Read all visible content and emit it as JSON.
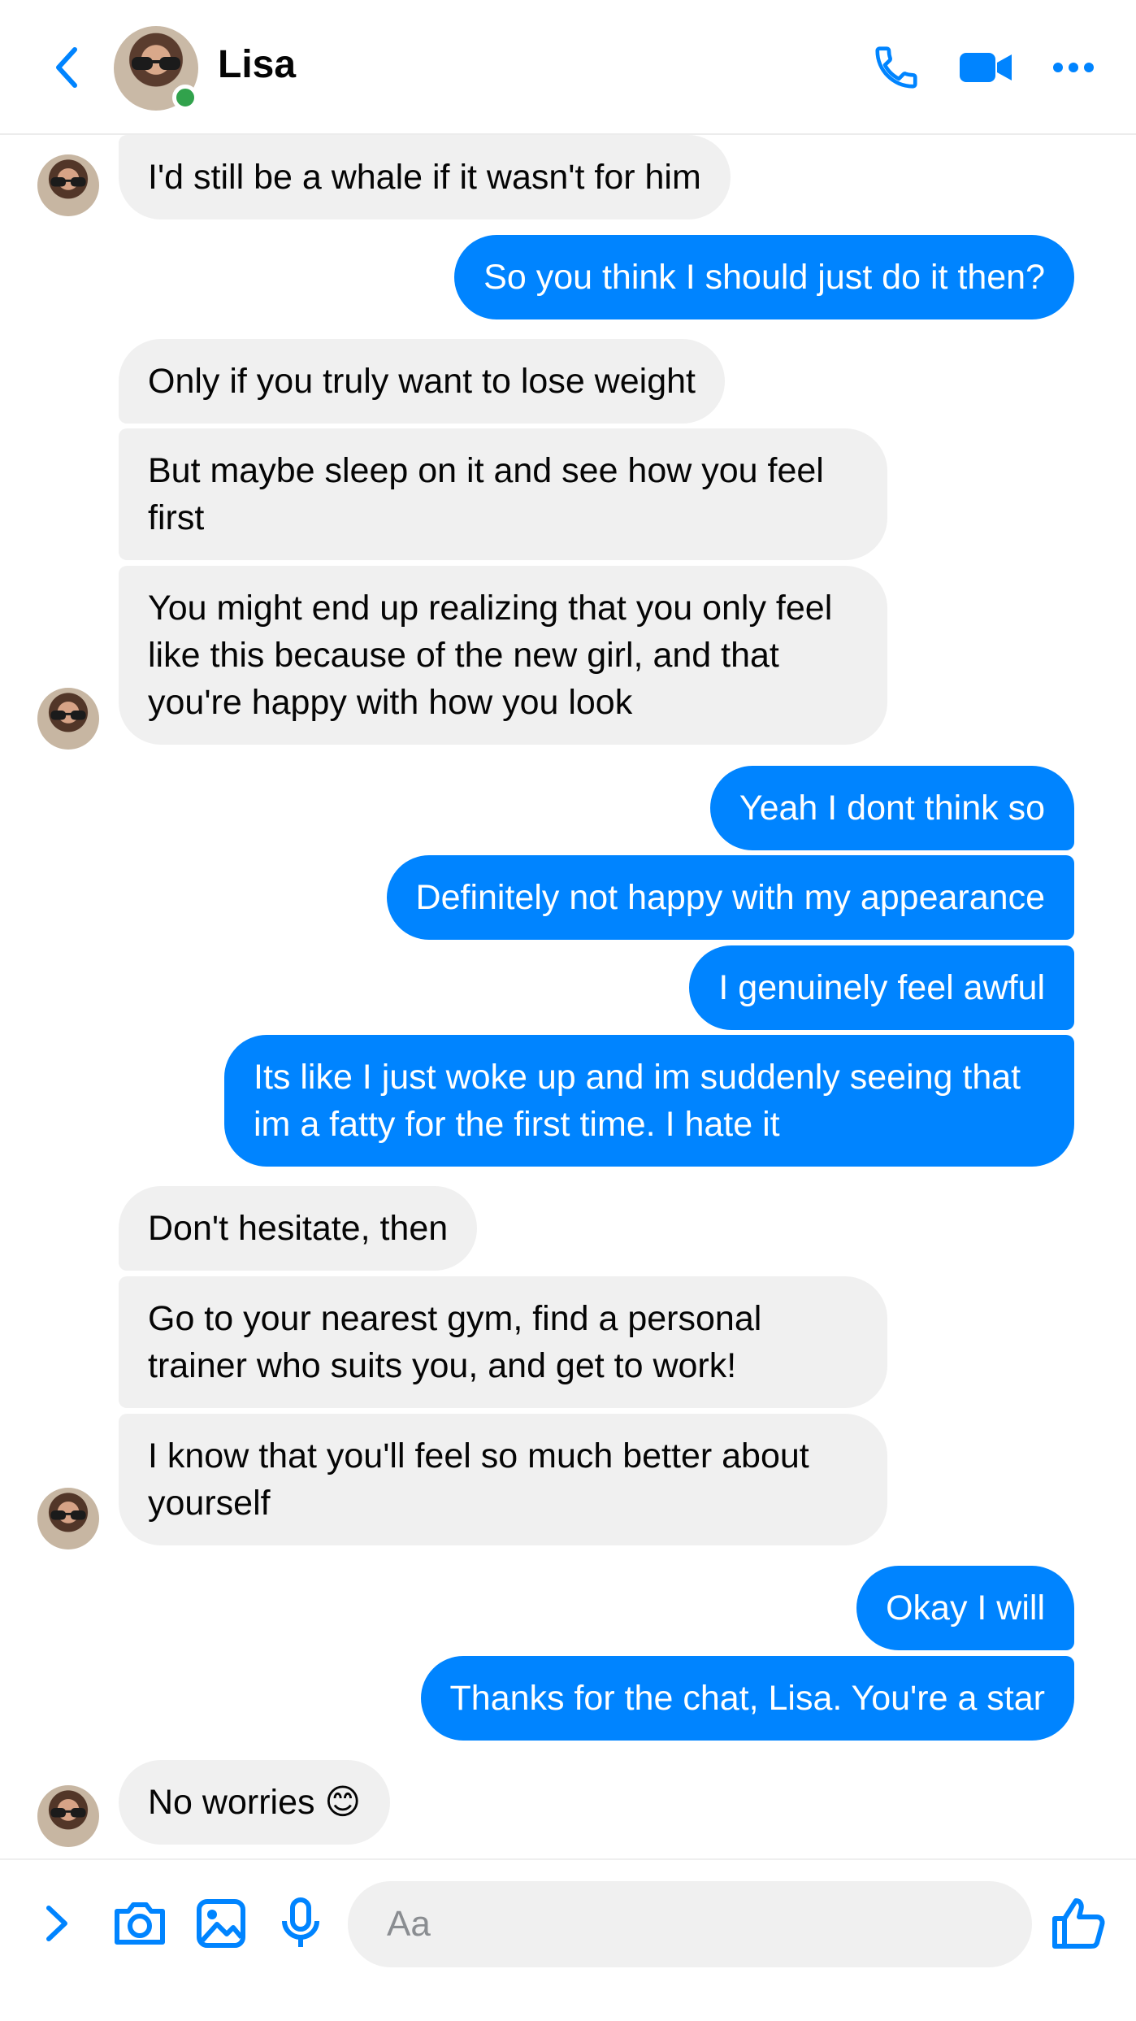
{
  "header": {
    "contact_name": "Lisa",
    "status": "online",
    "icons": [
      "back-chevron-icon",
      "phone-icon",
      "video-camera-icon",
      "more-icon"
    ]
  },
  "colors": {
    "accent": "#0084ff",
    "incoming_bubble": "#f0f0f0",
    "online": "#31a24c"
  },
  "messages": [
    {
      "dir": "in",
      "text": "I'd still be a whale if it wasn't for him"
    },
    {
      "dir": "out",
      "text": "So you think I should just do it then?"
    },
    {
      "dir": "in",
      "text": "Only if you truly want to lose weight"
    },
    {
      "dir": "in",
      "text": "But maybe sleep on it and see how you feel first"
    },
    {
      "dir": "in",
      "text": "You might end up realizing that you only feel like this because of the new girl, and that you're happy with how you look"
    },
    {
      "dir": "out",
      "text": "Yeah I dont think so"
    },
    {
      "dir": "out",
      "text": "Definitely not happy with my appearance"
    },
    {
      "dir": "out",
      "text": "I genuinely feel awful"
    },
    {
      "dir": "out",
      "text": "Its like I just woke up and im suddenly seeing that im a fatty for the first time. I hate it"
    },
    {
      "dir": "in",
      "text": "Don't hesitate, then"
    },
    {
      "dir": "in",
      "text": "Go to your nearest gym, find a personal trainer who suits you, and get to work!"
    },
    {
      "dir": "in",
      "text": "I know that you'll feel so much better about yourself"
    },
    {
      "dir": "out",
      "text": "Okay I will"
    },
    {
      "dir": "out",
      "text": "Thanks for the chat, Lisa. You're a star"
    },
    {
      "dir": "in",
      "text": "No worries 😊"
    }
  ],
  "composer": {
    "placeholder": "Aa",
    "icons": [
      "expand-chevron-icon",
      "camera-icon",
      "gallery-icon",
      "microphone-icon",
      "thumbs-up-icon"
    ]
  }
}
